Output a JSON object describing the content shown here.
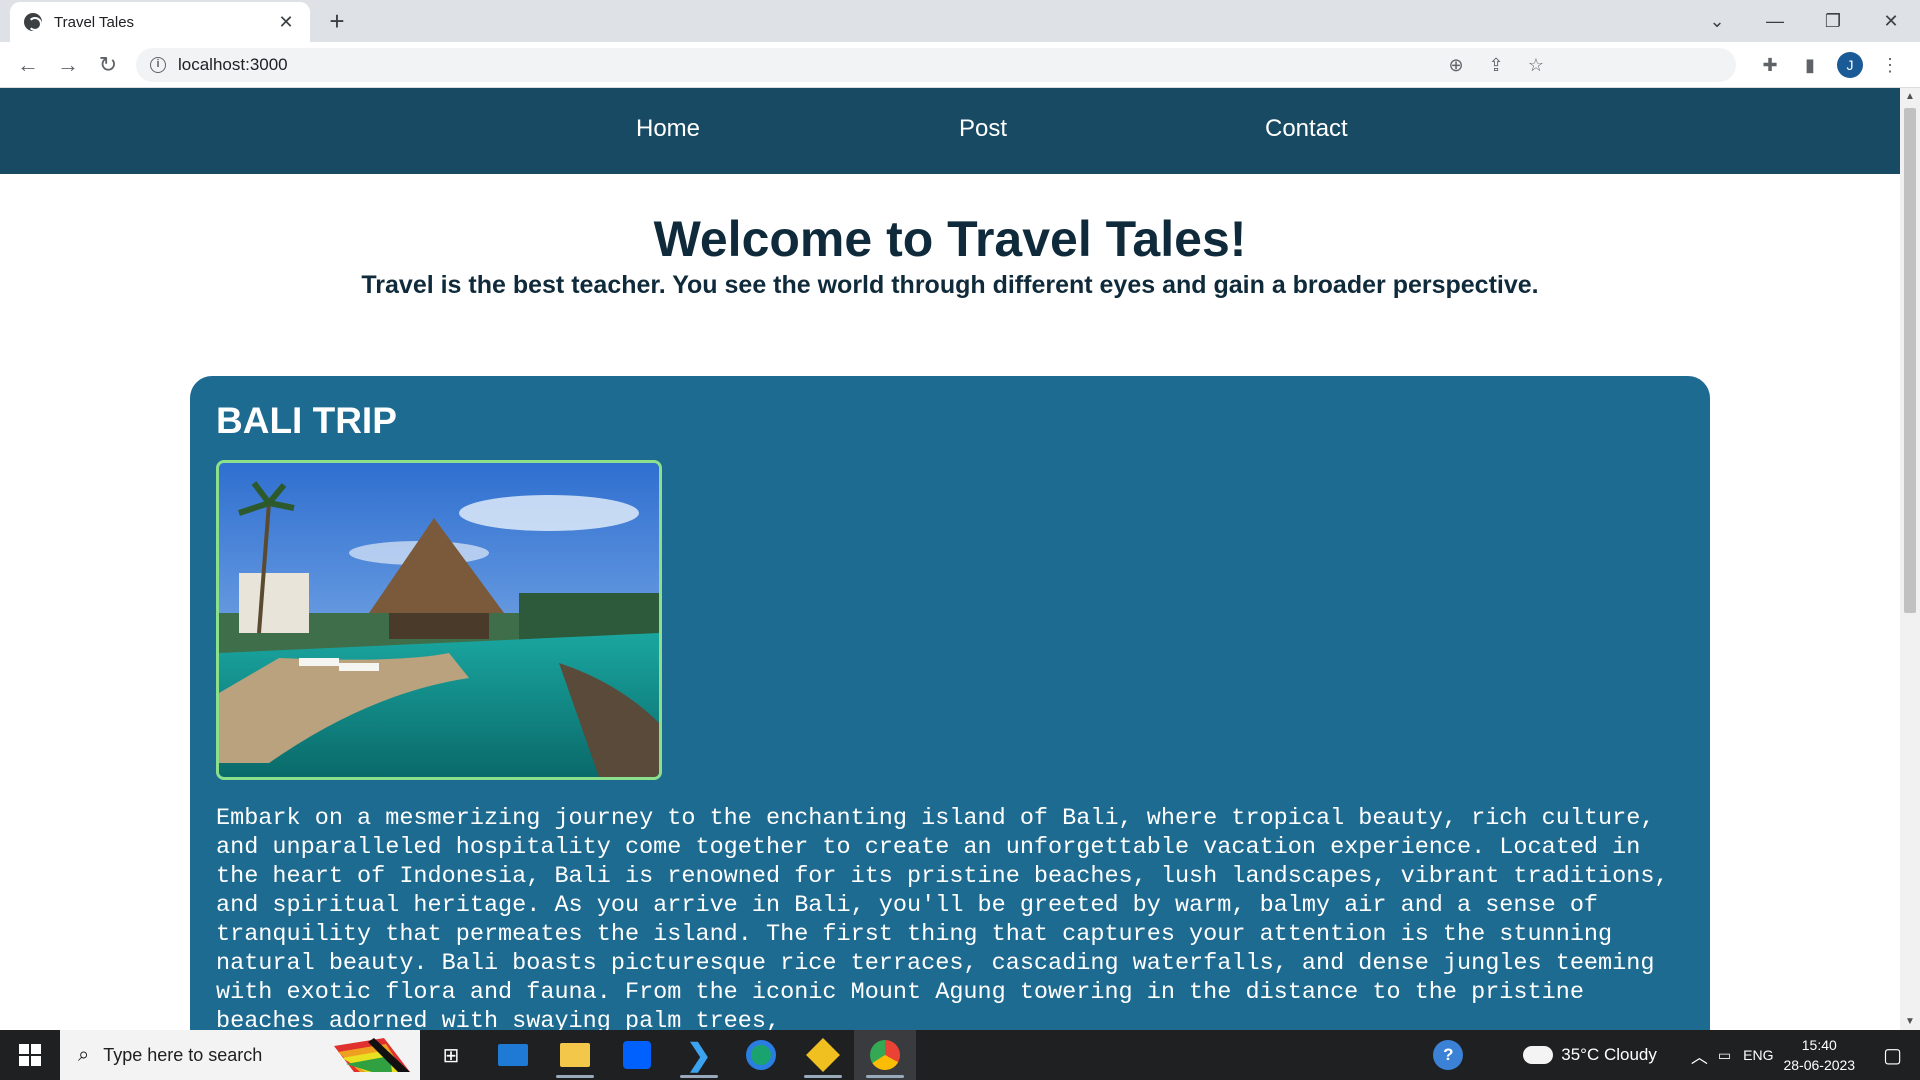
{
  "browser": {
    "tab_title": "Travel Tales",
    "tab_close": "✕",
    "new_tab": "+",
    "url": "localhost:3000",
    "window_controls": [
      "⌄",
      "—",
      "❐",
      "✕"
    ],
    "nav": {
      "back": "←",
      "forward": "→",
      "reload": "↻"
    },
    "omnibox_icons": [
      "zoom-icon",
      "share-icon",
      "star-icon"
    ],
    "toolbar_icons": [
      "extensions-icon",
      "sidepanel-icon",
      "profile-avatar",
      "menu-icon"
    ],
    "avatar_letter": "J"
  },
  "site": {
    "nav": [
      "Home",
      "Post",
      "Contact"
    ],
    "title": "Welcome to Travel Tales!",
    "subtitle": "Travel is the best teacher. You see the world through different eyes and gain a broader perspective.",
    "post": {
      "title": "BALI TRIP",
      "body": "Embark on a mesmerizing journey to the enchanting island of Bali, where tropical beauty, rich culture, and unparalleled hospitality come together to create an unforgettable vacation experience. Located in the heart of Indonesia, Bali is renowned for its pristine beaches, lush landscapes, vibrant traditions, and spiritual heritage. As you arrive in Bali, you'll be greeted by warm, balmy air and a sense of tranquility that permeates the island. The first thing that captures your attention is the stunning natural beauty. Bali boasts picturesque rice terraces, cascading waterfalls, and dense jungles teeming with exotic flora and fauna. From the iconic Mount Agung towering in the distance to the pristine beaches adorned with swaying palm trees,"
    }
  },
  "taskbar": {
    "search_placeholder": "Type here to search",
    "weather": "35°C  Cloudy",
    "language": "ENG",
    "time": "15:40",
    "date": "28-06-2023"
  },
  "colors": {
    "nav_bg": "#184b63",
    "card_bg": "#1e6b91",
    "heading": "#0f2a3a",
    "image_border": "#8de08b"
  }
}
